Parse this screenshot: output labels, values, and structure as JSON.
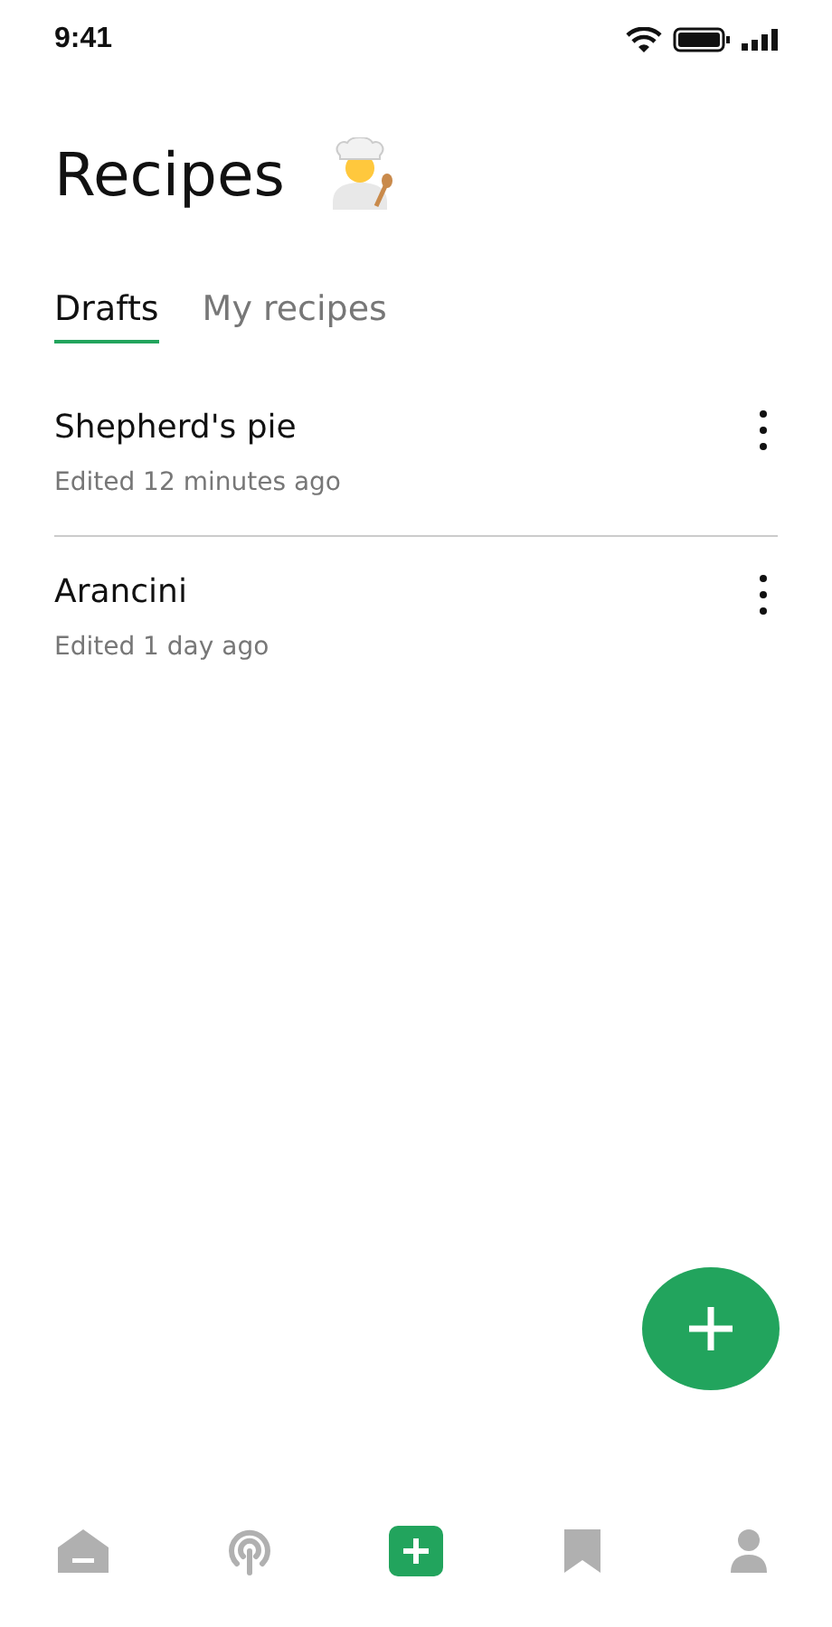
{
  "status_bar": {
    "time": "9:41"
  },
  "title": "Recipes",
  "tabs": [
    {
      "label": "Drafts",
      "selected": true
    },
    {
      "label": "My recipes",
      "selected": false
    }
  ],
  "drafts": [
    {
      "name": "Shepherd's pie",
      "edited": "Edited 12 minutes ago"
    },
    {
      "name": "Arancini",
      "edited": "Edited 1 day ago"
    }
  ],
  "fab": {
    "kind": "add"
  },
  "nav": [
    {
      "kind": "home",
      "selected": false
    },
    {
      "kind": "podcast",
      "selected": false
    },
    {
      "kind": "add",
      "selected": true
    },
    {
      "kind": "bookmark",
      "selected": false
    },
    {
      "kind": "profile",
      "selected": false
    }
  ]
}
